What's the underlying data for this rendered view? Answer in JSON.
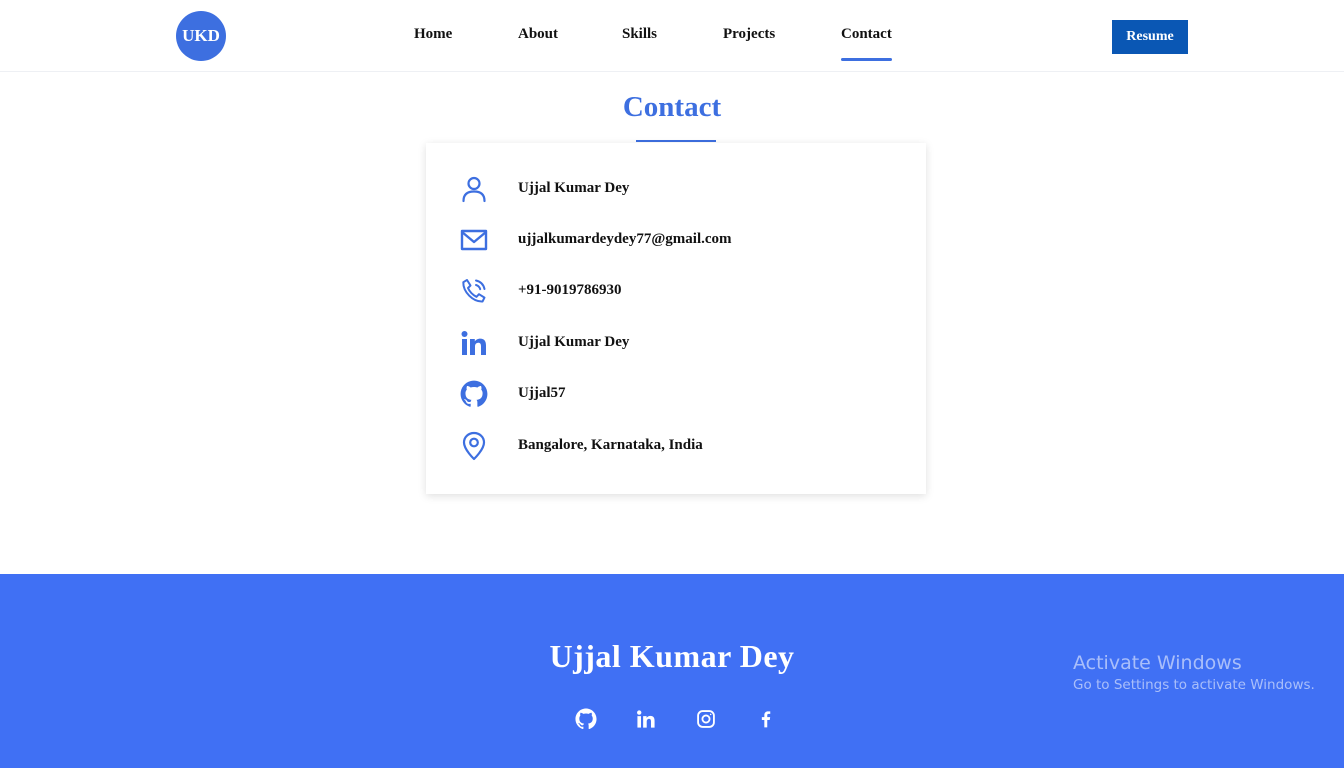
{
  "header": {
    "logo_text": "UKD",
    "nav": [
      "Home",
      "About",
      "Skills",
      "Projects",
      "Contact"
    ],
    "active_nav": "Contact",
    "resume_label": "Resume"
  },
  "contact": {
    "title": "Contact",
    "items": [
      {
        "icon": "person-icon",
        "text": "Ujjal Kumar Dey"
      },
      {
        "icon": "mail-icon",
        "text": "ujjalkumardeydey77@gmail.com"
      },
      {
        "icon": "phone-icon",
        "text": "+91-9019786930"
      },
      {
        "icon": "linkedin-icon",
        "text": "Ujjal Kumar Dey"
      },
      {
        "icon": "github-icon",
        "text": "Ujjal57"
      },
      {
        "icon": "location-icon",
        "text": "Bangalore, Karnataka, India"
      }
    ]
  },
  "footer": {
    "name": "Ujjal Kumar Dey",
    "socials": [
      "github-icon",
      "linkedin-icon",
      "instagram-icon",
      "facebook-icon"
    ]
  },
  "watermark": {
    "title": "Activate Windows",
    "subtitle": "Go to Settings to activate Windows."
  },
  "colors": {
    "accent": "#3d6fe0",
    "footer_bg": "#4070f4",
    "resume_bg": "#0a57b4"
  }
}
